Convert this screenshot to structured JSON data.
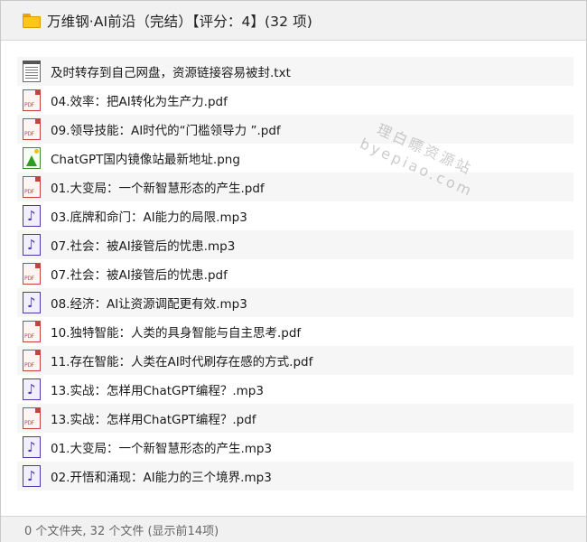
{
  "header": {
    "title": "万维钢·AI前沿（完结）【评分：4】(32 项)",
    "icon": "folder-icon"
  },
  "files": [
    {
      "name": "及时转存到自己网盘，资源链接容易被封.txt",
      "type": "txt"
    },
    {
      "name": "04.效率：把AI转化为生产力.pdf",
      "type": "pdf"
    },
    {
      "name": "09.领导技能：AI时代的“门槛领导力 ”.pdf",
      "type": "pdf"
    },
    {
      "name": "ChatGPT国内镜像站最新地址.png",
      "type": "png"
    },
    {
      "name": "01.大变局：一个新智慧形态的产生.pdf",
      "type": "pdf"
    },
    {
      "name": "03.底牌和命门：AI能力的局限.mp3",
      "type": "mp3"
    },
    {
      "name": "07.社会：被AI接管后的忧患.mp3",
      "type": "mp3"
    },
    {
      "name": "07.社会：被AI接管后的忧患.pdf",
      "type": "pdf"
    },
    {
      "name": "08.经济：AI让资源调配更有效.mp3",
      "type": "mp3"
    },
    {
      "name": "10.独特智能：人类的具身智能与自主思考.pdf",
      "type": "pdf"
    },
    {
      "name": "11.存在智能：人类在AI时代刷存在感的方式.pdf",
      "type": "pdf"
    },
    {
      "name": "13.实战：怎样用ChatGPT编程？.mp3",
      "type": "mp3"
    },
    {
      "name": "13.实战：怎样用ChatGPT编程？.pdf",
      "type": "pdf"
    },
    {
      "name": "01.大变局：一个新智慧形态的产生.mp3",
      "type": "mp3"
    },
    {
      "name": "02.开悟和涌现：AI能力的三个境界.mp3",
      "type": "mp3"
    }
  ],
  "watermark": {
    "line1": "理白瞟资源站",
    "line2": "byepiao.com"
  },
  "footer": {
    "status": "0 个文件夹, 32 个文件 (显示前14项)"
  },
  "colors": {
    "pdf": "#c0443f",
    "mp3": "#4a3aa8",
    "png": "#2f9c22",
    "folder": "#ffc619"
  }
}
